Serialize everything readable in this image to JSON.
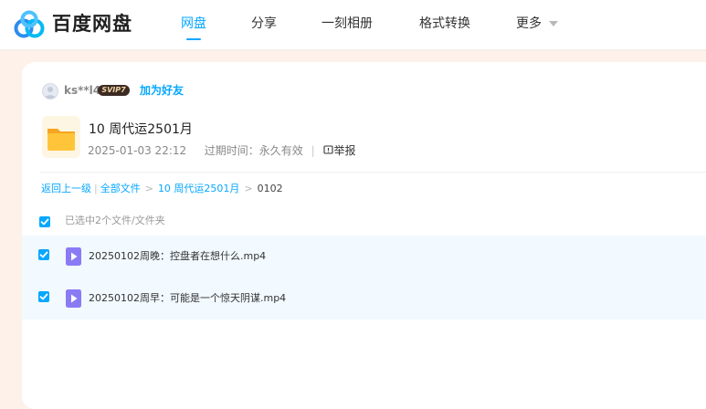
{
  "header": {
    "brand": "百度网盘",
    "nav": [
      {
        "label": "网盘",
        "active": true
      },
      {
        "label": "分享",
        "active": false
      },
      {
        "label": "一刻相册",
        "active": false
      },
      {
        "label": "格式转换",
        "active": false
      },
      {
        "label": "更多",
        "active": false
      }
    ]
  },
  "sharer": {
    "name": "ks**l4",
    "badge": "SVIP7",
    "add_friend": "加为好友"
  },
  "folder": {
    "title": "10 周代运2501月",
    "date": "2025-01-03 22:12",
    "expiry": "过期时间：永久有效",
    "report": "举报"
  },
  "breadcrumb": {
    "back": "返回上一级",
    "all": "全部文件",
    "parent": "10 周代运2501月",
    "current": "0102"
  },
  "selection": {
    "summary": "已选中2个文件/文件夹"
  },
  "files": [
    {
      "name": "20250102周晚：控盘者在想什么.mp4",
      "checked": true
    },
    {
      "name": "20250102周早：可能是一个惊天阴谋.mp4",
      "checked": true
    }
  ],
  "colors": {
    "accent": "#06a7ff",
    "page_bg": "#fdf1ea",
    "row_selected": "#f2f9ff",
    "folder_yellow": "#ffc53a",
    "video_purple": "#8a7bf5"
  },
  "icons": {
    "logo": "baidu-netdisk-logo",
    "folder": "folder-icon",
    "video": "video-file-icon",
    "report": "report-icon",
    "checkbox": "checkbox-checked-icon",
    "more": "caret-down-icon"
  }
}
